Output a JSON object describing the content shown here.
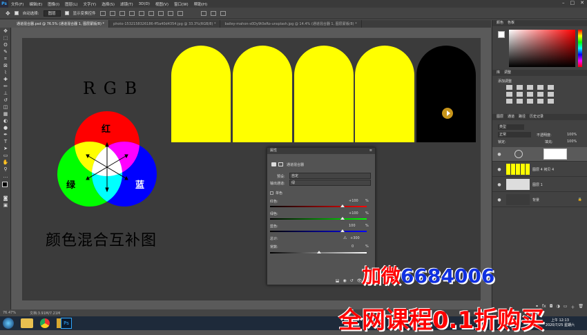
{
  "app": {
    "logo": "Ps"
  },
  "menu": [
    "文件(F)",
    "编辑(E)",
    "图像(I)",
    "图层(L)",
    "文字(Y)",
    "选择(S)",
    "滤镜(T)",
    "3D(D)",
    "视图(V)",
    "窗口(W)",
    "帮助(H)"
  ],
  "options": {
    "auto_select_label": "自动选择:",
    "auto_select_value": "图层",
    "show_transform": "显示变换控件"
  },
  "tabs": [
    "通道混合器.psd @ 76.5% (通道混合器 1, 图层蒙版/8) *",
    "photo-1532158326186-ff5a40d4354.jpg @ 33.3%(RGB/8) *",
    "bailey-mahon-s0Dy9t0eRo-unsplash.jpg @ 14.4% (通道混合器 1, 图层蒙版/8) *"
  ],
  "canvas": {
    "rgb_title": "R G B",
    "labels": {
      "red": "红",
      "green": "绿",
      "blue": "蓝"
    },
    "caption": "颜色混合互补图",
    "colors": {
      "arch_yellow": "#FFFF00",
      "arch_black": "#000000",
      "red": "#FF0000",
      "green": "#00FF00",
      "blue": "#0000FF"
    }
  },
  "status": {
    "zoom": "76.47%",
    "doc": "文档:3.91M/7.21M"
  },
  "properties": {
    "title": "属性",
    "subtitle": "通道混合器",
    "preset_label": "预设:",
    "preset_value": "自定",
    "output_label": "输出通道:",
    "output_value": "绿",
    "mono_label": "单色",
    "channels": [
      {
        "name": "红色:",
        "value": "+100",
        "unit": "%",
        "level": 100,
        "color": "red"
      },
      {
        "name": "绿色:",
        "value": "+100",
        "unit": "%",
        "level": 100,
        "color": "green"
      },
      {
        "name": "蓝色:",
        "value": "100",
        "unit": "%",
        "level": 100,
        "color": "blue"
      }
    ],
    "total_label": "总计:",
    "total_value": "+300",
    "constant_label": "常数:",
    "constant_value": "0",
    "constant_unit": "%"
  },
  "panels": {
    "color_tabs": [
      "颜色",
      "色板"
    ],
    "adjust_tabs": [
      "库",
      "调整"
    ],
    "adjust_add": "添加调整",
    "layer_tabs": [
      "图层",
      "通道",
      "路径",
      "历史记录"
    ],
    "kind": "类型",
    "blend_mode": "正常",
    "opacity_label": "不透明度:",
    "opacity_value": "100%",
    "lock_label": "锁定:",
    "fill_label": "填充:",
    "fill_value": "100%",
    "layers": [
      {
        "name": "",
        "type": "adjustment"
      },
      {
        "name": "图层 4 拷贝 4",
        "type": "image"
      },
      {
        "name": "图层 1",
        "type": "image"
      },
      {
        "name": "背景",
        "type": "background"
      }
    ]
  },
  "overlay": {
    "line1_a": "加微",
    "line1_b": "6684006",
    "line2": "全网课程0.1折购买"
  },
  "taskbar": {
    "time": "上午 12:13",
    "date": "2020/7/25 星期六"
  }
}
